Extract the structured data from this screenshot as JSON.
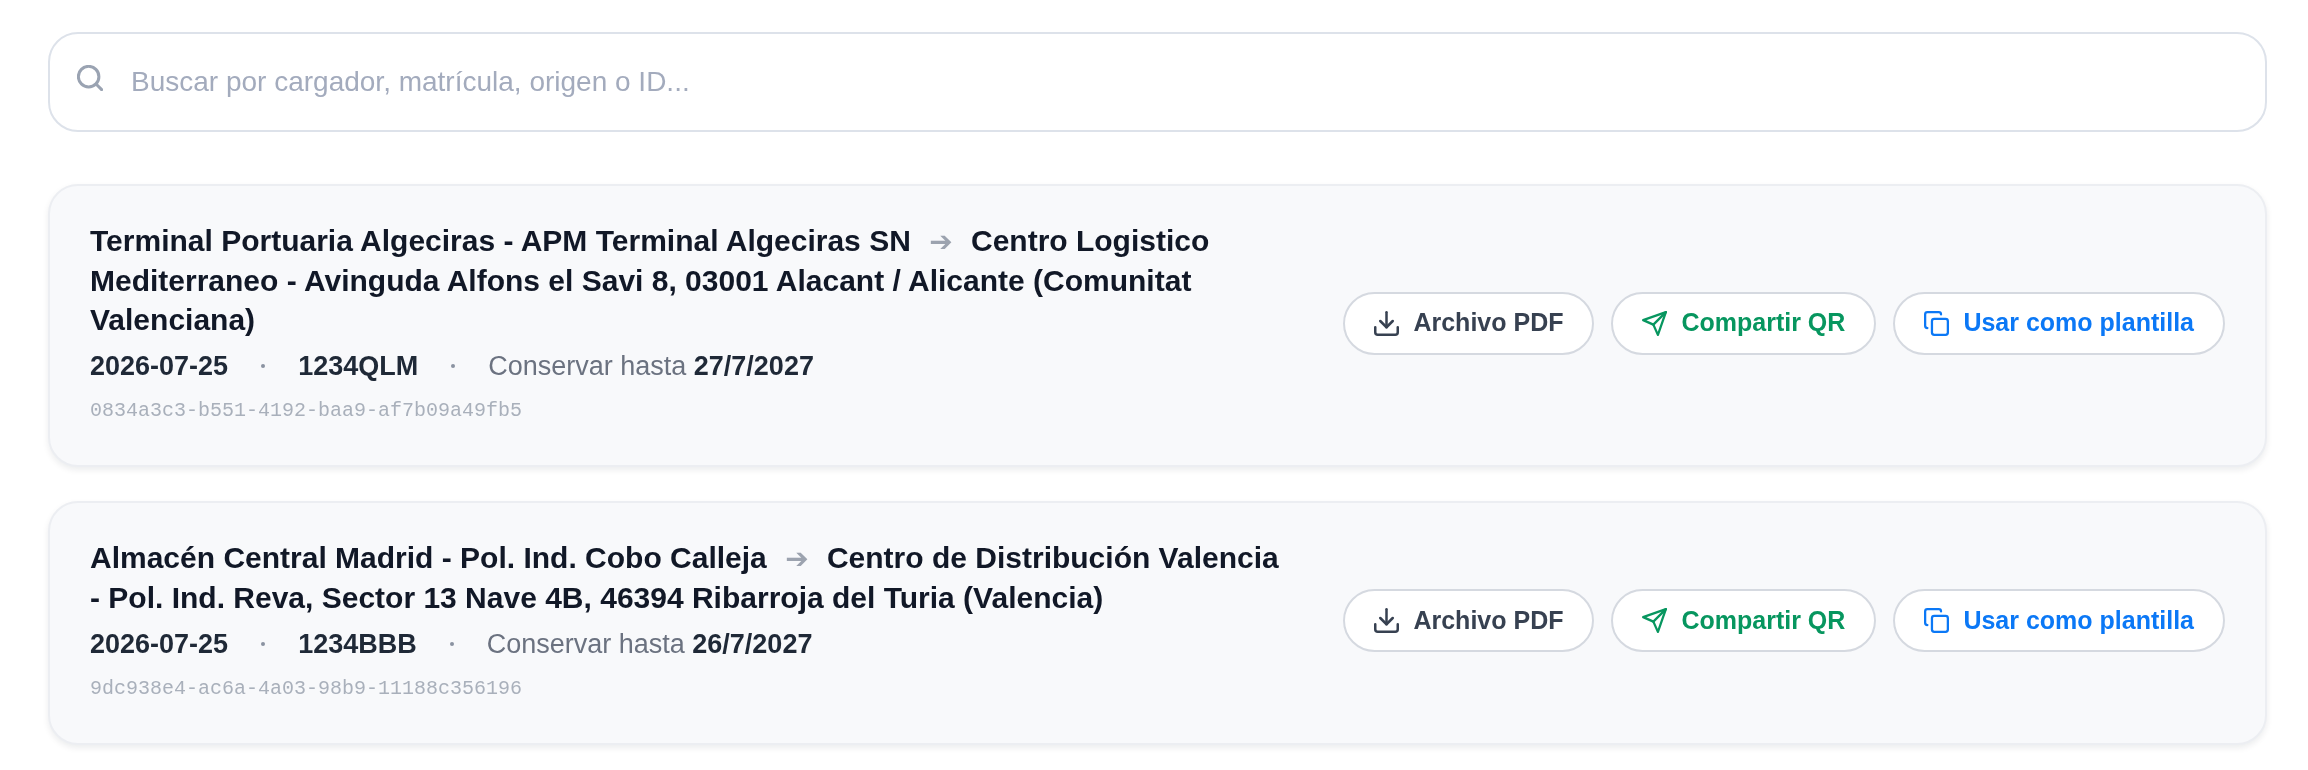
{
  "search": {
    "placeholder": "Buscar por cargador, matrícula, origen o ID..."
  },
  "shipments": [
    {
      "origin": "Terminal Portuaria Algeciras - APM Terminal Algeciras SN",
      "arrow": "➔",
      "destination": "Centro Logistico Mediterraneo - Avinguda Alfons el Savi 8, 03001 Alacant / Alicante (Comunitat Valenciana)",
      "date": "2026-07-25",
      "plate": "1234QLM",
      "retention": "Conservar hasta **27/7/2027**",
      "id": "0834a3c3-b551-4192-baa9-af7b09a49fb5",
      "actions": [
        {
          "kind": "pdf",
          "label": "Archivo PDF"
        },
        {
          "kind": "share",
          "label": "Compartir QR"
        },
        {
          "kind": "template",
          "label": "Usar como plantilla"
        }
      ]
    },
    {
      "origin": "Almacén Central Madrid - Pol. Ind. Cobo Calleja",
      "arrow": "➔",
      "destination": "Centro de Distribución Valencia - Pol. Ind. Reva, Sector 13 Nave 4B, 46394 Ribarroja del Turia (Valencia)",
      "date": "2026-07-25",
      "plate": "1234BBB",
      "retention": "Conservar hasta **26/7/2027**",
      "id": "9dc938e4-ac6a-4a03-98b9-11188c356196",
      "actions": [
        {
          "kind": "pdf",
          "label": "Archivo PDF"
        },
        {
          "kind": "share",
          "label": "Compartir QR"
        },
        {
          "kind": "template",
          "label": "Usar como plantilla"
        }
      ]
    }
  ]
}
